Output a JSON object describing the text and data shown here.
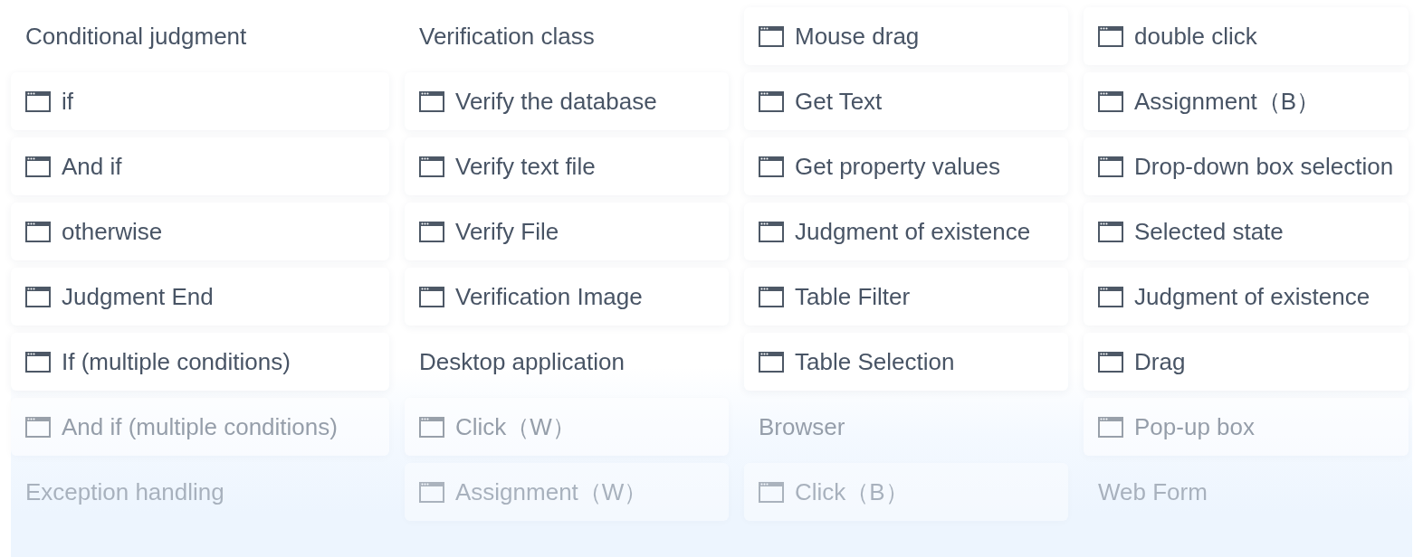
{
  "columns": [
    {
      "items": [
        {
          "kind": "heading",
          "label": "Conditional judgment"
        },
        {
          "kind": "action",
          "label": "if"
        },
        {
          "kind": "action",
          "label": "And if"
        },
        {
          "kind": "action",
          "label": "otherwise"
        },
        {
          "kind": "action",
          "label": "Judgment End"
        },
        {
          "kind": "action",
          "label": "If (multiple conditions)"
        },
        {
          "kind": "action",
          "label": "And if (multiple conditions)"
        },
        {
          "kind": "heading",
          "label": "Exception handling"
        }
      ]
    },
    {
      "items": [
        {
          "kind": "heading",
          "label": "Verification class"
        },
        {
          "kind": "action",
          "label": "Verify the database"
        },
        {
          "kind": "action",
          "label": "Verify text file"
        },
        {
          "kind": "action",
          "label": "Verify File"
        },
        {
          "kind": "action",
          "label": "Verification Image"
        },
        {
          "kind": "heading",
          "label": "Desktop application"
        },
        {
          "kind": "action",
          "label": "Click（W）"
        },
        {
          "kind": "action",
          "label": "Assignment（W）"
        }
      ]
    },
    {
      "items": [
        {
          "kind": "action",
          "label": "Mouse drag"
        },
        {
          "kind": "action",
          "label": "Get Text"
        },
        {
          "kind": "action",
          "label": "Get property values"
        },
        {
          "kind": "action",
          "label": "Judgment of existence"
        },
        {
          "kind": "action",
          "label": "Table Filter"
        },
        {
          "kind": "action",
          "label": "Table Selection"
        },
        {
          "kind": "heading",
          "label": "Browser"
        },
        {
          "kind": "action",
          "label": "Click（B）"
        }
      ]
    },
    {
      "items": [
        {
          "kind": "action",
          "label": "double click"
        },
        {
          "kind": "action",
          "label": "Assignment（B）"
        },
        {
          "kind": "action",
          "label": "Drop-down box selection"
        },
        {
          "kind": "action",
          "label": "Selected state"
        },
        {
          "kind": "action",
          "label": "Judgment of existence"
        },
        {
          "kind": "action",
          "label": "Drag"
        },
        {
          "kind": "action",
          "label": "Pop-up box"
        },
        {
          "kind": "heading",
          "label": "Web Form"
        }
      ]
    }
  ]
}
